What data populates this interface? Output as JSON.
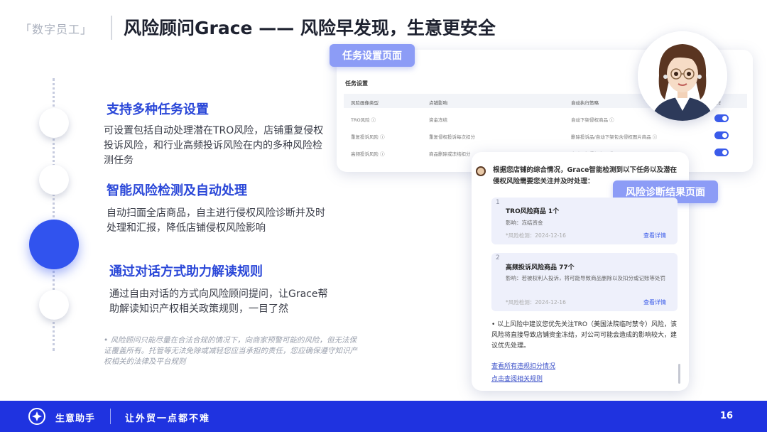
{
  "header": {
    "tag": "「数字员工」",
    "title": "风险顾问Grace —— 风险早发现，生意更安全"
  },
  "features": [
    {
      "title": "支持多种任务设置",
      "desc": "可设置包括自动处理潜在TRO风险，店铺重复侵权投诉风险，和行业高频投诉风险在内的多种风险检测任务"
    },
    {
      "title": "智能风险检测及自动处理",
      "desc": "自动扫面全店商品，自主进行侵权风险诊断并及时处理和汇报，降低店铺侵权风险影响"
    },
    {
      "title": "通过对话方式助力解读规则",
      "desc": "通过自由对话的方式向风险顾问提问，让Grace帮助解读知识产权相关政策规则，一目了然"
    }
  ],
  "disclaimer": "• 风险顾问只能尽量在合法合规的情况下，向商家预警可能的风险，但无法保证覆盖所有。托管等无法免除或减轻您应当承担的责任，您应确保遵守知识产权相关的法律及平台规则",
  "task_page": {
    "label": "任务设置页面",
    "heading": "任务设置",
    "columns": [
      "风险画像类型",
      "点铺影响",
      "自动执行策略",
      "操作"
    ],
    "rows": [
      {
        "type": "TRO风险 ⓘ",
        "impact": "资金冻结",
        "strategy": "自动下架侵权商品 ⓘ",
        "enabled": true
      },
      {
        "type": "重复投诉风险 ⓘ",
        "impact": "重复侵权投诉每次扣分",
        "strategy": "删除投诉品/自动下架包含侵权图片商品 ⓘ",
        "enabled": true
      },
      {
        "type": "高频投诉风险 ⓘ",
        "impact": "商品删除或冻结扣分",
        "strategy": "自动下架侵权商品 ⓘ",
        "enabled": true
      }
    ]
  },
  "result_page": {
    "label": "风险诊断结果页面",
    "intro": "根据您店铺的综合情况，Grace智能检测到以下任务以及潜在侵权风险需要您关注并及时处理：",
    "items": [
      {
        "num": "1",
        "title": "TRO风险商品 1个",
        "impact": "影响：冻结资金",
        "time": "*风险检测：2024-12-16",
        "link": "查看详情"
      },
      {
        "num": "2",
        "title": "高频投诉风险商品 77个",
        "impact": "影响：若被权利人投诉，将可能导致商品删除以及扣分或记账等处罚",
        "time": "*风险检测：2024-12-16",
        "link": "查看详情"
      }
    ],
    "note": "以上风险中建议您优先关注TRO（美国法院临时禁令）风险，该风险将直接导致店铺资金冻结，对公司可能会造成的影响较大，建议优先处理。",
    "links": [
      "查看所有违规扣分情况",
      "点击查阅相关规则"
    ]
  },
  "footer": {
    "brand": "生意助手",
    "slogan": "让外贸一点都不难",
    "page": "16"
  },
  "colors": {
    "accent": "#3153ee",
    "footer": "#1f33e0",
    "feature_title": "#2a47d8",
    "chip": "#8c9cf6"
  }
}
